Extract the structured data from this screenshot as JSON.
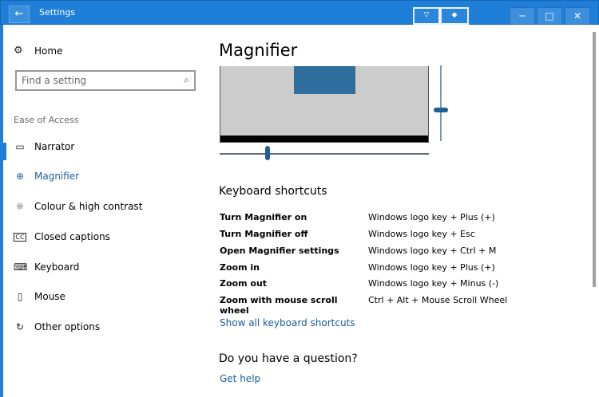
{
  "titlebar": {
    "back_label": "←",
    "title": "Settings",
    "float_btn_1": "▽",
    "float_btn_2": "◆",
    "min_label": "─",
    "max_label": "□",
    "close_label": "✕"
  },
  "sidebar": {
    "home_label": "Home",
    "search_placeholder": "Find a setting",
    "section_label": "Ease of Access",
    "items": [
      {
        "label": "Narrator",
        "icon": "narrator-icon"
      },
      {
        "label": "Magnifier",
        "icon": "magnifier-icon"
      },
      {
        "label": "Colour & high contrast",
        "icon": "brightness-icon"
      },
      {
        "label": "Closed captions",
        "icon": "captions-icon"
      },
      {
        "label": "Keyboard",
        "icon": "keyboard-icon"
      },
      {
        "label": "Mouse",
        "icon": "mouse-icon"
      },
      {
        "label": "Other options",
        "icon": "other-options-icon"
      }
    ]
  },
  "main": {
    "page_title": "Magnifier",
    "kb_title": "Keyboard shortcuts",
    "shortcuts": [
      {
        "action": "Turn Magnifier on",
        "keys": "Windows logo key + Plus (+)"
      },
      {
        "action": "Turn Magnifier off",
        "keys": "Windows logo key + Esc"
      },
      {
        "action": "Open Magnifier settings",
        "keys": "Windows logo key + Ctrl + M"
      },
      {
        "action": "Zoom in",
        "keys": "Windows logo key + Plus (+)"
      },
      {
        "action": "Zoom out",
        "keys": "Windows logo key + Minus (-)"
      },
      {
        "action": "Zoom with mouse scroll wheel",
        "keys": "Ctrl + Alt + Mouse Scroll Wheel"
      }
    ],
    "show_all_link": "Show all keyboard shortcuts",
    "question_title": "Do you have a question?",
    "get_help_link": "Get help"
  },
  "colors": {
    "accent": "#1e7ed8",
    "link": "#1b5d9c",
    "preview_blue": "#2f6e9d"
  }
}
